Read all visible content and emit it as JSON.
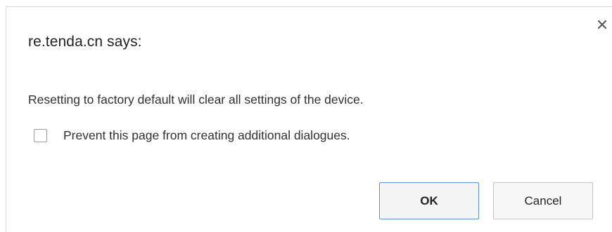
{
  "dialog": {
    "title": "re.tenda.cn says:",
    "message": "Resetting to factory default will clear all settings of the device.",
    "checkbox_label": "Prevent this page from creating additional dialogues.",
    "checkbox_checked": false,
    "ok_label": "OK",
    "cancel_label": "Cancel",
    "close_icon": "close-icon"
  },
  "colors": {
    "ok_border": "#5b8fd6",
    "button_bg": "#f7f7f7",
    "text": "#222222"
  }
}
